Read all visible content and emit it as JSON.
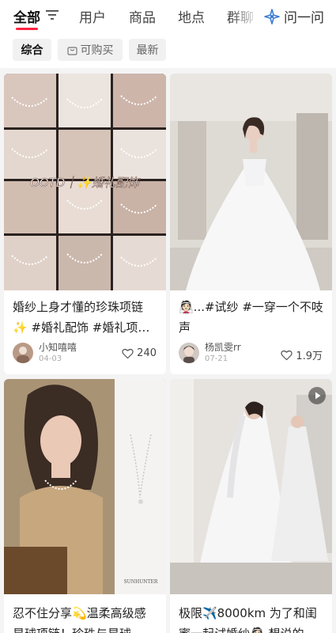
{
  "top_tabs": [
    {
      "label": "全部",
      "active": true
    },
    {
      "label": "用户"
    },
    {
      "label": "商品"
    },
    {
      "label": "地点"
    },
    {
      "label": "群聊"
    }
  ],
  "ask_button": {
    "label": "问一问",
    "icon": "sparkle-icon"
  },
  "filter_chips": [
    {
      "label": "综合",
      "active": true
    },
    {
      "label": "可购买",
      "icon": "shopping-bag-icon"
    },
    {
      "label": "最新"
    }
  ],
  "cards": [
    {
      "image_caption": "OOTD｜✨婚礼配饰",
      "title_line1": "婚纱上身才懂的珍珠项链",
      "title_line2": "✨ #婚礼配饰 #婚礼项…",
      "author": "小知嘻嘻",
      "date": "04-03",
      "likes": "240"
    },
    {
      "title_line1": "👰🏻...#试纱 #一穿一个不吱",
      "title_line2": "声",
      "author": "杨凯雯rr",
      "date": "07-21",
      "likes": "1.9万"
    },
    {
      "image_caption": "SUNHUNTER",
      "title_line1": "忍不住分享💫温柔高级感",
      "title_line2": "星球项链！珍珠与星球…"
    },
    {
      "title_line1": "极限✈️8000km 为了和闺",
      "title_line2": "蜜一起试婚纱👰🏻 想说的…",
      "has_video": true
    }
  ],
  "colors": {
    "accent": "#ff2442",
    "background": "#f4f4f4"
  }
}
